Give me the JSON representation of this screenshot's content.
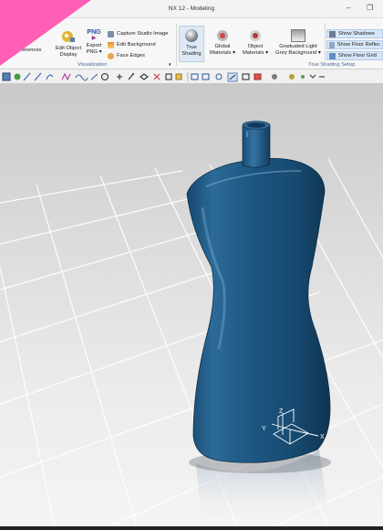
{
  "window": {
    "title": "NX 12 - Modeling",
    "minimize_glyph": "–",
    "restore_glyph": "❐"
  },
  "ribbon": {
    "references_label": "eferences",
    "edit_object_display": [
      "Edit Object",
      "Display"
    ],
    "export_png": {
      "icon_text": "PNG",
      "label": [
        "Export",
        "PNG ▾"
      ]
    },
    "capture_studio_image": "Capture Studio Image",
    "edit_background": "Edit Background",
    "face_edges": "Face Edges",
    "visualization_group": "Visualization",
    "true_shading": [
      "True",
      "Shading"
    ],
    "global_materials": [
      "Global",
      "Materials ▾"
    ],
    "object_materials": [
      "Object",
      "Materials ▾"
    ],
    "graduated_background": [
      "Graduated Light",
      "Grey Background ▾"
    ],
    "show_shadows": "Show Shadows",
    "show_floor_reflection": "Show Floor Reflec",
    "show_floor_grid": "Show Floor Grid",
    "true_shading_setup_group": "True Shading Setup"
  },
  "axes": {
    "x": "X",
    "y": "Y",
    "z": "Z"
  },
  "colors": {
    "accent": "#2f6db3",
    "model": "#1b4f78",
    "corner_marker": "#ff5fb4"
  },
  "icons": [
    "minimize-icon",
    "restore-icon",
    "edit-object-display-icon",
    "export-png-icon",
    "camera-icon",
    "background-icon",
    "face-edges-icon",
    "true-shading-icon",
    "global-materials-icon",
    "object-materials-icon",
    "background-preset-icon",
    "shadow-icon",
    "reflection-icon",
    "floor-grid-icon"
  ]
}
